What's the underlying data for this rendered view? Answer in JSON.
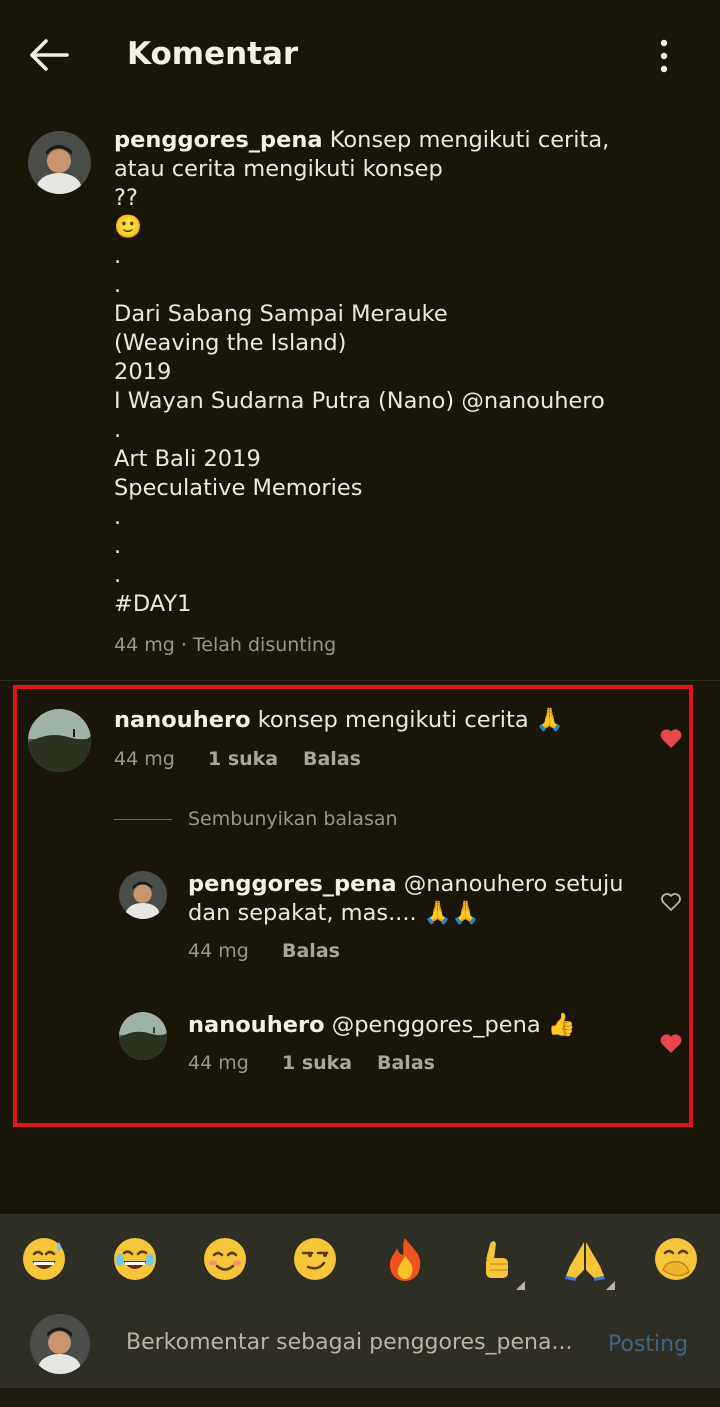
{
  "header": {
    "title": "Komentar",
    "back_icon": "arrow-left-icon",
    "more_icon": "more-vertical-icon"
  },
  "post": {
    "username": "penggores_pena",
    "caption_lines": [
      "Konsep mengikuti cerita,",
      "atau cerita mengikuti konsep",
      "??",
      "🙂",
      ".",
      ".",
      "Dari Sabang Sampai Merauke",
      "(Weaving the Island)",
      "2019",
      "I Wayan Sudarna Putra (Nano) @nanouhero",
      ".",
      "Art Bali 2019",
      "Speculative Memories",
      ".",
      ".",
      ".",
      "#DAY1"
    ],
    "meta": "44 mg · Telah disunting"
  },
  "comments": [
    {
      "username": "nanouhero",
      "text": "konsep mengikuti cerita 🙏",
      "time": "44 mg",
      "likes": "1 suka",
      "reply": "Balas",
      "liked": true
    }
  ],
  "hide_replies": "Sembunyikan balasan",
  "replies": [
    {
      "username": "penggores_pena",
      "text_line1": "@nanouhero setuju",
      "text_line2": "dan sepakat, mas.... 🙏🙏",
      "time": "44 mg",
      "reply": "Balas",
      "liked": false
    },
    {
      "username": "nanouhero",
      "text": "@penggores_pena 👍",
      "time": "44 mg",
      "likes": "1 suka",
      "reply": "Balas",
      "liked": true
    }
  ],
  "emoji_bar": [
    "😅",
    "😂",
    "😊",
    "😏",
    "🔥",
    "👍",
    "🙏",
    "🤭"
  ],
  "composer": {
    "placeholder": "Berkomentar sebagai penggores_pena...",
    "post_label": "Posting"
  },
  "colors": {
    "background": "#191509",
    "highlight": "#e4141c",
    "heart": "#e5484d",
    "post": "#3e6684"
  }
}
